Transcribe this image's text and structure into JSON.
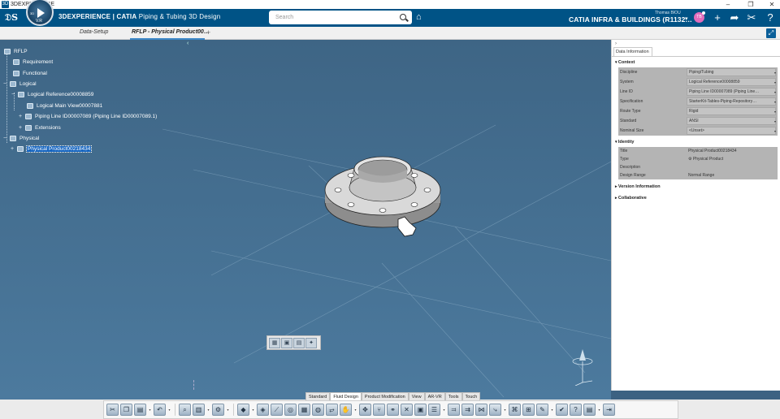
{
  "window": {
    "title": "3DEXPERIENCE",
    "controls": [
      "–",
      "❐",
      "✕"
    ]
  },
  "header": {
    "brand": "3DEXPERIENCE | CATIA",
    "app_name": "Piping & Tubing 3D Design",
    "search_placeholder": "Search",
    "platform": "CATIA INFRA & BUILDINGS (R1132…",
    "user_name": "Thomas BIOU",
    "avatar_initials": "TB",
    "compass_version": "V.R",
    "compass_label": "3D"
  },
  "tabs": {
    "items": [
      {
        "label": "Data-Setup"
      },
      {
        "label": "RFLP - Physical Product00…"
      }
    ],
    "add": "+"
  },
  "tree": {
    "root": "RFLP",
    "items": [
      {
        "label": "Requirement"
      },
      {
        "label": "Functional"
      },
      {
        "label": "Logical"
      },
      {
        "label": "Logical Reference00008859"
      },
      {
        "label": "Logical Main View00007881"
      },
      {
        "label": "Piping Line ID00007089 (Piping Line ID00007089.1)"
      },
      {
        "label": "Extensions"
      },
      {
        "label": "Physical"
      },
      {
        "label": "Physical Product00218434"
      }
    ],
    "collapse": "‹"
  },
  "panel": {
    "toggle": "›",
    "tab": "Data Information",
    "context": {
      "title": "Context",
      "rows": [
        {
          "k": "Discipline",
          "v": "Piping/Tubing"
        },
        {
          "k": "System",
          "v": "Logical Reference00008859"
        },
        {
          "k": "Line ID",
          "v": "Piping Line ID00007089 (Piping Line…"
        },
        {
          "k": "Specification",
          "v": "StarterKit-Tables-Piping-Repository…"
        },
        {
          "k": "Route Type",
          "v": "Rigid"
        },
        {
          "k": "Standard",
          "v": "ANSI"
        },
        {
          "k": "Nominal Size",
          "v": "<Unset>"
        }
      ]
    },
    "identity": {
      "title": "Identity",
      "rows": [
        {
          "k": "Title",
          "v": "Physical Product00218434"
        },
        {
          "k": "Type",
          "v": "Physical Product"
        },
        {
          "k": "Description",
          "v": ""
        },
        {
          "k": "Design Range",
          "v": "Normal Range"
        }
      ]
    },
    "version": "Version Information",
    "collaborative": "Collaborative"
  },
  "ribbon_tabs": [
    "Standard",
    "Fluid Design",
    "Product Modification",
    "View",
    "AR-VR",
    "Tools",
    "Touch"
  ],
  "ribbon_active": "Fluid Design",
  "colors": {
    "topbar": "#005386",
    "viewport": "#416a8a",
    "selection": "#1565c0",
    "avatar": "#e16cbc"
  }
}
